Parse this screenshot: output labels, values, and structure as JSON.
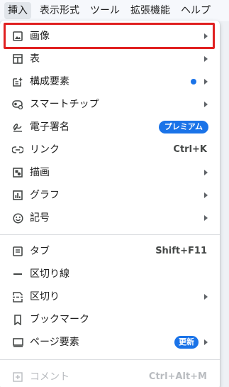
{
  "menubar": {
    "items": [
      "挿入",
      "表示形式",
      "ツール",
      "拡張機能",
      "ヘルプ"
    ]
  },
  "menu": {
    "items": [
      {
        "label": "画像",
        "icon": "image-icon",
        "submenu": true
      },
      {
        "label": "表",
        "icon": "table-icon",
        "submenu": true
      },
      {
        "label": "構成要素",
        "icon": "building-blocks-icon",
        "submenu": true,
        "indicator": "blue-dot"
      },
      {
        "label": "スマートチップ",
        "icon": "smart-chip-icon",
        "submenu": true
      },
      {
        "label": "電子署名",
        "icon": "signature-icon",
        "badge": "プレミアム"
      },
      {
        "label": "リンク",
        "icon": "link-icon",
        "shortcut": "Ctrl+K"
      },
      {
        "label": "描画",
        "icon": "drawing-icon",
        "submenu": true
      },
      {
        "label": "グラフ",
        "icon": "chart-icon",
        "submenu": true
      },
      {
        "label": "記号",
        "icon": "emoji-icon",
        "submenu": true
      },
      {
        "label": "タブ",
        "icon": "tab-icon",
        "shortcut": "Shift+F11"
      },
      {
        "label": "区切り線",
        "icon": "horizontal-line-icon"
      },
      {
        "label": "区切り",
        "icon": "break-icon",
        "submenu": true
      },
      {
        "label": "ブックマーク",
        "icon": "bookmark-icon"
      },
      {
        "label": "ページ要素",
        "icon": "page-elements-icon",
        "submenu": true,
        "badge": "更新"
      },
      {
        "label": "コメント",
        "icon": "add-comment-icon",
        "shortcut": "Ctrl+Alt+M",
        "disabled": true
      }
    ]
  },
  "colors": {
    "highlight": "#e02020",
    "accent": "#1a73e8",
    "menubar_bg": "#f6f8fc"
  }
}
